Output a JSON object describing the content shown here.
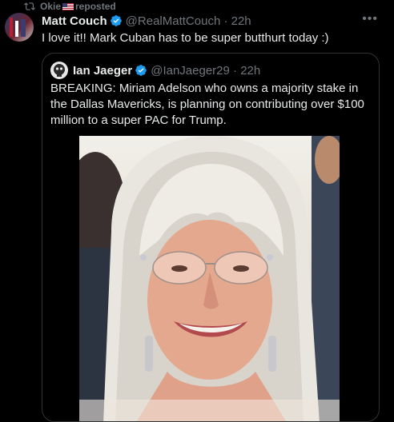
{
  "repost": {
    "user_label": "Okie",
    "flag_icon": "us-flag-icon",
    "suffix": "reposted"
  },
  "tweet": {
    "name": "Matt Couch",
    "handle": "@RealMattCouch",
    "time": "22h",
    "text": "I love it!! Mark Cuban has to be super butthurt today :)",
    "more_icon": "more-icon"
  },
  "quote": {
    "name": "Ian Jaeger",
    "handle": "@IanJaeger29",
    "time": "22h",
    "text": "BREAKING: Miriam Adelson who owns a majority stake in the Dallas Mavericks, is planning on contributing over $100 million to a super PAC for Trump."
  },
  "colors": {
    "background": "#000000",
    "text": "#e7e9ea",
    "muted": "#71767b",
    "verified": "#1d9bf0",
    "border": "#2f3336"
  }
}
